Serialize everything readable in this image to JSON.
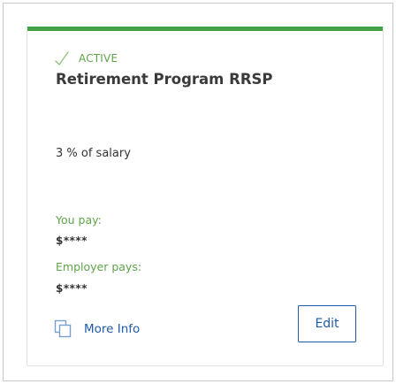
{
  "card": {
    "status": "ACTIVE",
    "status_icon": "check-icon",
    "title": "Retirement Program RRSP",
    "contribution": "3 % of salary",
    "you_pay_label": "You pay:",
    "you_pay_value": "$****",
    "employer_pays_label": "Employer pays:",
    "employer_pays_value": "$****",
    "more_info_icon": "copy-icon",
    "more_info_label": "More Info",
    "edit_label": "Edit"
  },
  "colors": {
    "accent": "#43a047",
    "status_green": "#5ea44a",
    "link_blue": "#1e5ba8",
    "title_text": "#3a3a3a"
  }
}
